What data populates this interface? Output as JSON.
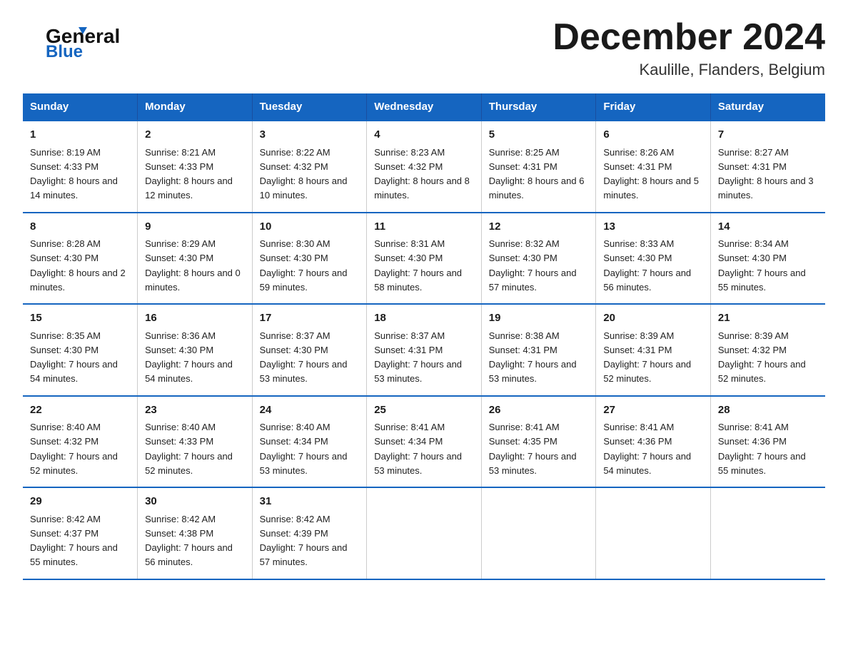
{
  "header": {
    "logo": {
      "general": "General",
      "blue": "Blue",
      "arrow": "▶"
    },
    "title": "December 2024",
    "subtitle": "Kaulille, Flanders, Belgium"
  },
  "calendar": {
    "days": [
      "Sunday",
      "Monday",
      "Tuesday",
      "Wednesday",
      "Thursday",
      "Friday",
      "Saturday"
    ],
    "weeks": [
      [
        {
          "date": "1",
          "sunrise": "8:19 AM",
          "sunset": "4:33 PM",
          "daylight": "8 hours and 14 minutes."
        },
        {
          "date": "2",
          "sunrise": "8:21 AM",
          "sunset": "4:33 PM",
          "daylight": "8 hours and 12 minutes."
        },
        {
          "date": "3",
          "sunrise": "8:22 AM",
          "sunset": "4:32 PM",
          "daylight": "8 hours and 10 minutes."
        },
        {
          "date": "4",
          "sunrise": "8:23 AM",
          "sunset": "4:32 PM",
          "daylight": "8 hours and 8 minutes."
        },
        {
          "date": "5",
          "sunrise": "8:25 AM",
          "sunset": "4:31 PM",
          "daylight": "8 hours and 6 minutes."
        },
        {
          "date": "6",
          "sunrise": "8:26 AM",
          "sunset": "4:31 PM",
          "daylight": "8 hours and 5 minutes."
        },
        {
          "date": "7",
          "sunrise": "8:27 AM",
          "sunset": "4:31 PM",
          "daylight": "8 hours and 3 minutes."
        }
      ],
      [
        {
          "date": "8",
          "sunrise": "8:28 AM",
          "sunset": "4:30 PM",
          "daylight": "8 hours and 2 minutes."
        },
        {
          "date": "9",
          "sunrise": "8:29 AM",
          "sunset": "4:30 PM",
          "daylight": "8 hours and 0 minutes."
        },
        {
          "date": "10",
          "sunrise": "8:30 AM",
          "sunset": "4:30 PM",
          "daylight": "7 hours and 59 minutes."
        },
        {
          "date": "11",
          "sunrise": "8:31 AM",
          "sunset": "4:30 PM",
          "daylight": "7 hours and 58 minutes."
        },
        {
          "date": "12",
          "sunrise": "8:32 AM",
          "sunset": "4:30 PM",
          "daylight": "7 hours and 57 minutes."
        },
        {
          "date": "13",
          "sunrise": "8:33 AM",
          "sunset": "4:30 PM",
          "daylight": "7 hours and 56 minutes."
        },
        {
          "date": "14",
          "sunrise": "8:34 AM",
          "sunset": "4:30 PM",
          "daylight": "7 hours and 55 minutes."
        }
      ],
      [
        {
          "date": "15",
          "sunrise": "8:35 AM",
          "sunset": "4:30 PM",
          "daylight": "7 hours and 54 minutes."
        },
        {
          "date": "16",
          "sunrise": "8:36 AM",
          "sunset": "4:30 PM",
          "daylight": "7 hours and 54 minutes."
        },
        {
          "date": "17",
          "sunrise": "8:37 AM",
          "sunset": "4:30 PM",
          "daylight": "7 hours and 53 minutes."
        },
        {
          "date": "18",
          "sunrise": "8:37 AM",
          "sunset": "4:31 PM",
          "daylight": "7 hours and 53 minutes."
        },
        {
          "date": "19",
          "sunrise": "8:38 AM",
          "sunset": "4:31 PM",
          "daylight": "7 hours and 53 minutes."
        },
        {
          "date": "20",
          "sunrise": "8:39 AM",
          "sunset": "4:31 PM",
          "daylight": "7 hours and 52 minutes."
        },
        {
          "date": "21",
          "sunrise": "8:39 AM",
          "sunset": "4:32 PM",
          "daylight": "7 hours and 52 minutes."
        }
      ],
      [
        {
          "date": "22",
          "sunrise": "8:40 AM",
          "sunset": "4:32 PM",
          "daylight": "7 hours and 52 minutes."
        },
        {
          "date": "23",
          "sunrise": "8:40 AM",
          "sunset": "4:33 PM",
          "daylight": "7 hours and 52 minutes."
        },
        {
          "date": "24",
          "sunrise": "8:40 AM",
          "sunset": "4:34 PM",
          "daylight": "7 hours and 53 minutes."
        },
        {
          "date": "25",
          "sunrise": "8:41 AM",
          "sunset": "4:34 PM",
          "daylight": "7 hours and 53 minutes."
        },
        {
          "date": "26",
          "sunrise": "8:41 AM",
          "sunset": "4:35 PM",
          "daylight": "7 hours and 53 minutes."
        },
        {
          "date": "27",
          "sunrise": "8:41 AM",
          "sunset": "4:36 PM",
          "daylight": "7 hours and 54 minutes."
        },
        {
          "date": "28",
          "sunrise": "8:41 AM",
          "sunset": "4:36 PM",
          "daylight": "7 hours and 55 minutes."
        }
      ],
      [
        {
          "date": "29",
          "sunrise": "8:42 AM",
          "sunset": "4:37 PM",
          "daylight": "7 hours and 55 minutes."
        },
        {
          "date": "30",
          "sunrise": "8:42 AM",
          "sunset": "4:38 PM",
          "daylight": "7 hours and 56 minutes."
        },
        {
          "date": "31",
          "sunrise": "8:42 AM",
          "sunset": "4:39 PM",
          "daylight": "7 hours and 57 minutes."
        },
        {
          "date": "",
          "sunrise": "",
          "sunset": "",
          "daylight": ""
        },
        {
          "date": "",
          "sunrise": "",
          "sunset": "",
          "daylight": ""
        },
        {
          "date": "",
          "sunrise": "",
          "sunset": "",
          "daylight": ""
        },
        {
          "date": "",
          "sunrise": "",
          "sunset": "",
          "daylight": ""
        }
      ]
    ],
    "labels": {
      "sunrise": "Sunrise:",
      "sunset": "Sunset:",
      "daylight": "Daylight:"
    }
  }
}
